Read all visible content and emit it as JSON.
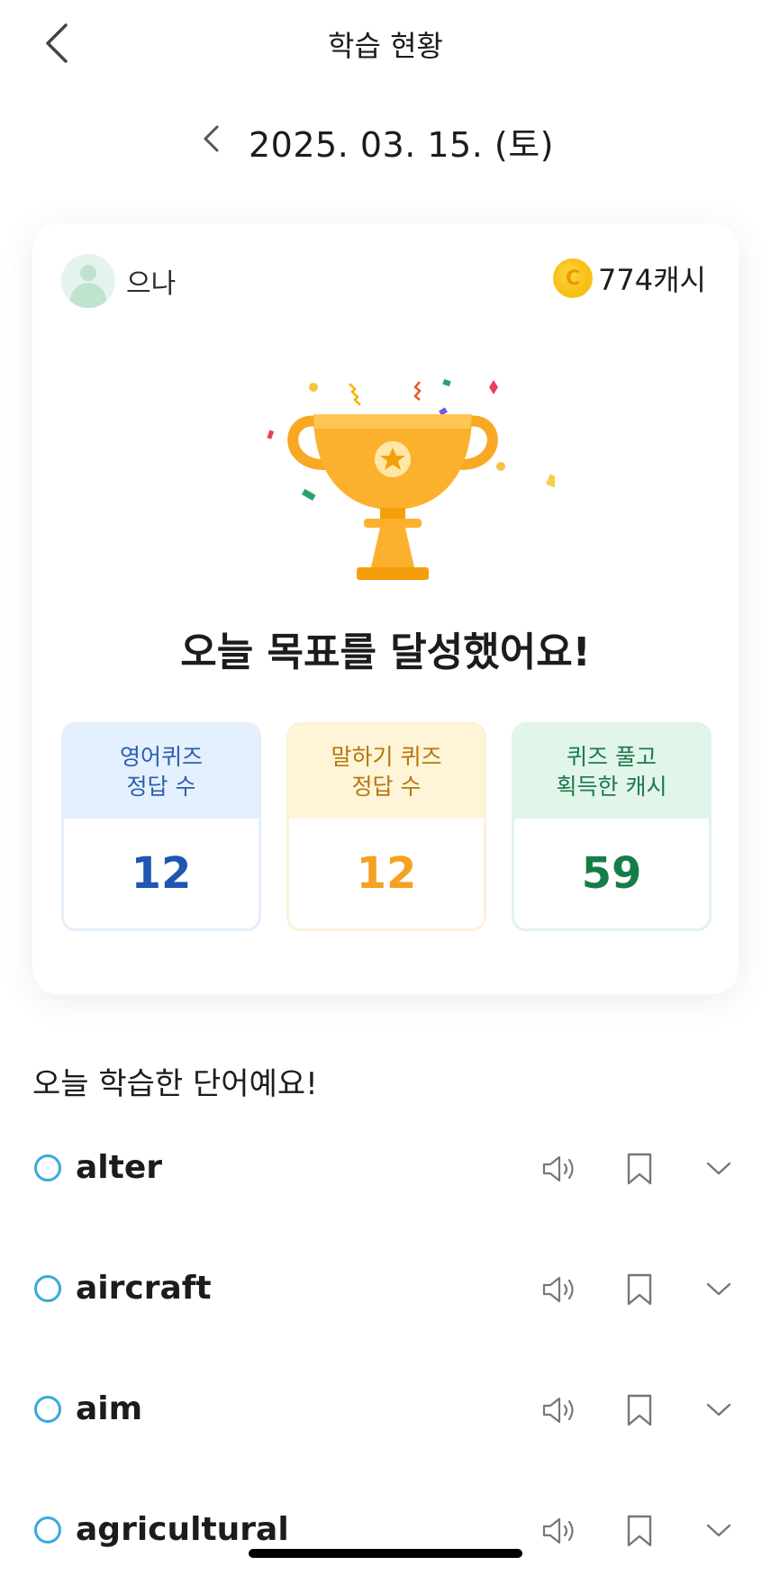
{
  "header": {
    "title": "학습 현황"
  },
  "date": {
    "label": "2025. 03. 15. (토)"
  },
  "card": {
    "user_name": "으나",
    "coin_symbol": "C",
    "cash": "774캐시",
    "goal_message": "오늘 목표를 달성했어요!",
    "stats": [
      {
        "line1": "영어퀴즈",
        "line2": "정답 수",
        "value": "12"
      },
      {
        "line1": "말하기 퀴즈",
        "line2": "정답 수",
        "value": "12"
      },
      {
        "line1": "퀴즈 풀고",
        "line2": "획득한 캐시",
        "value": "59"
      }
    ]
  },
  "words_section": {
    "title": "오늘 학습한 단어예요!",
    "words": [
      {
        "word": "alter"
      },
      {
        "word": "aircraft"
      },
      {
        "word": "aim"
      },
      {
        "word": "agricultural"
      }
    ]
  },
  "colors": {
    "blue_accent": "#1e56b0",
    "yellow_accent": "#f5a123",
    "green_accent": "#177d48",
    "check_circle": "#3aa8e0",
    "trophy": "#f8a823"
  }
}
